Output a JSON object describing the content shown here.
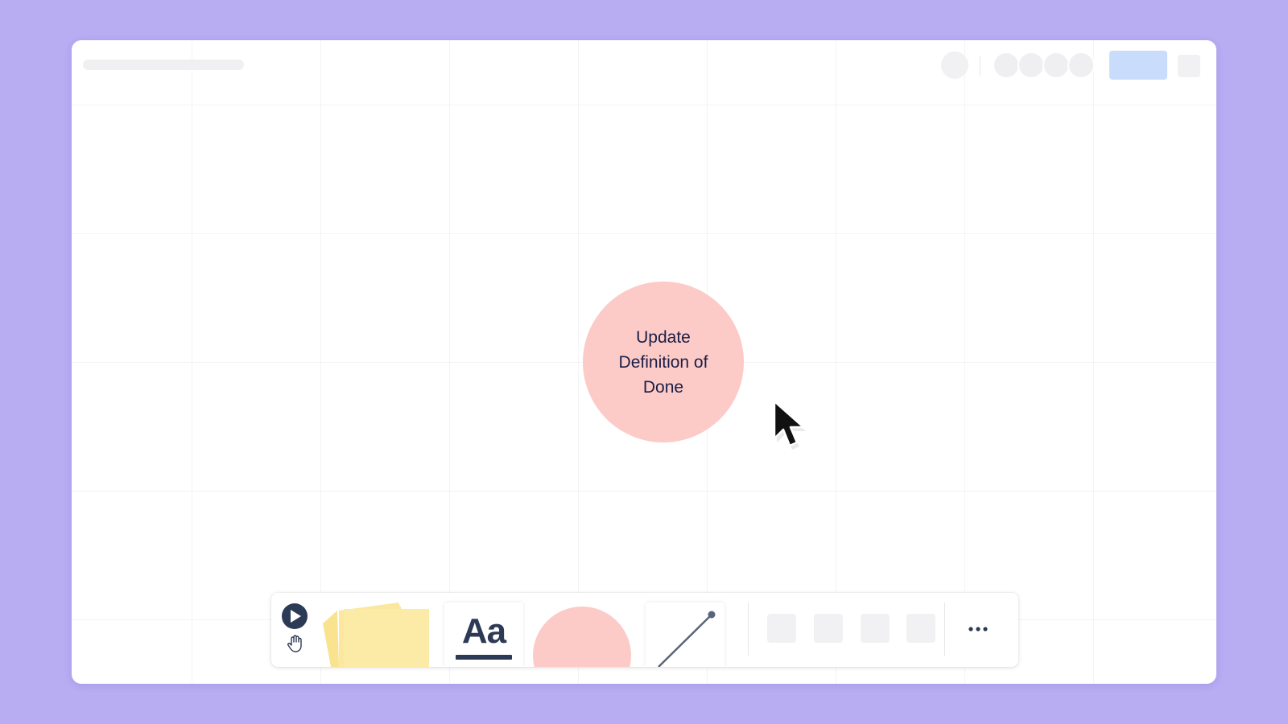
{
  "canvas": {
    "shape": {
      "text": "Update Definition of Done",
      "color": "#fccbc7",
      "text_color": "#1b1d46"
    }
  },
  "toolbar": {
    "select_tool": {
      "icon": "play-cursor-icon"
    },
    "hand_tool": {
      "icon": "hand-icon"
    },
    "sticky_note": {
      "icon": "sticky-note-icon",
      "color": "#fbe89e"
    },
    "text_tool": {
      "label": "Aa",
      "color": "#2d3a55"
    },
    "shape_tool": {
      "icon": "circle-shape-icon",
      "color": "#fccbc7"
    },
    "line_tool": {
      "icon": "line-connector-icon"
    },
    "more": {
      "icon": "more-dots-icon"
    }
  },
  "colors": {
    "background": "#b8acf3",
    "share_button": "#c9dcfb",
    "grid": "#ededf0"
  }
}
